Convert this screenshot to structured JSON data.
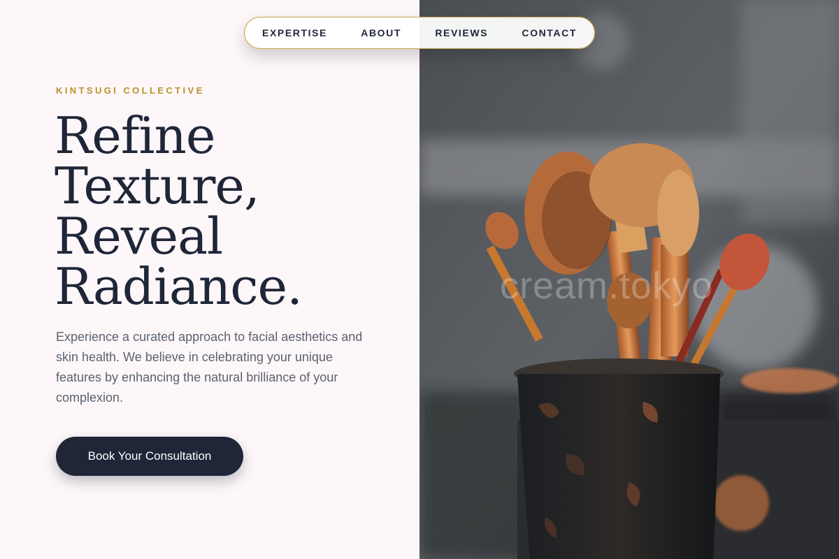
{
  "nav": {
    "items": [
      {
        "label": "EXPERTISE"
      },
      {
        "label": "ABOUT"
      },
      {
        "label": "REVIEWS"
      },
      {
        "label": "CONTACT"
      }
    ]
  },
  "hero": {
    "brand": "KINTSUGI COLLECTIVE",
    "headline": [
      "Refine",
      "Texture,",
      "Reveal",
      "Radiance."
    ],
    "description": "Experience a curated approach to facial aesthetics and skin health. We believe in celebrating your unique features by enhancing the natural brilliance of your complexion.",
    "cta_label": "Book Your Consultation"
  },
  "image": {
    "watermark": "cream.tokyo"
  },
  "colors": {
    "accent_gold": "#b8922b",
    "navy": "#1f2638",
    "background": "#fdf7f9"
  }
}
